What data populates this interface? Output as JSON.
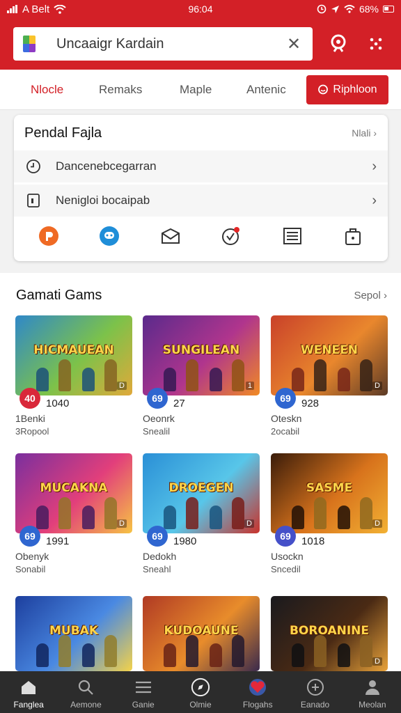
{
  "status_bar": {
    "carrier": "A Belt",
    "time": "96:04",
    "battery": "68%"
  },
  "search": {
    "value": "Uncaaigr Kardain"
  },
  "tabs": [
    {
      "label": "Nlocle",
      "active": true
    },
    {
      "label": "Remaks"
    },
    {
      "label": "Maple"
    },
    {
      "label": "Antenic"
    }
  ],
  "tab_cta": {
    "label": "Riphloon"
  },
  "card": {
    "title": "Pendal Fajla",
    "more": "Nlali",
    "rows": [
      {
        "label": "Dancenebcegarran"
      },
      {
        "label": "Nenigloi bocaipab"
      }
    ]
  },
  "games_section": {
    "title": "Gamati Gams",
    "more": "Sepol",
    "games": [
      {
        "art_title": "HICMAUEAN",
        "tag": "D",
        "badge": "40",
        "rating": "1040",
        "name": "1Benki",
        "sub": "3Ropool",
        "colors": [
          "#2f88c9",
          "#7cc24a",
          "#e0a93a"
        ],
        "badge_color": "#d9283a"
      },
      {
        "art_title": "SUNGILEAN",
        "tag": "1",
        "badge": "69",
        "rating": "27",
        "name": "Oeonrk",
        "sub": "Snealil",
        "colors": [
          "#5a2a8c",
          "#b0358d",
          "#f08a24"
        ],
        "badge_color": "#2f66d0"
      },
      {
        "art_title": "WENEEN",
        "tag": "D",
        "badge": "69",
        "rating": "928",
        "name": "Oteskn",
        "sub": "2ocabil",
        "colors": [
          "#c9412a",
          "#e9872d",
          "#5b3a26"
        ],
        "badge_color": "#2f66d0"
      },
      {
        "art_title": "MUCAKNA",
        "tag": "D",
        "badge": "69",
        "rating": "1991",
        "name": "Obenyk",
        "sub": "Sonabil",
        "colors": [
          "#7a2f9e",
          "#e23f7b",
          "#f6c344"
        ],
        "badge_color": "#2f66d0"
      },
      {
        "art_title": "DROEGEN",
        "tag": "D",
        "badge": "69",
        "rating": "1980",
        "name": "Dedokh",
        "sub": "Sneahl",
        "colors": [
          "#2a8fd6",
          "#58c6e9",
          "#c9322b"
        ],
        "badge_color": "#2f66d0"
      },
      {
        "art_title": "SASME",
        "tag": "D",
        "badge": "69",
        "rating": "1018",
        "name": "Usockn",
        "sub": "Sncedil",
        "colors": [
          "#3a1c0a",
          "#d8731c",
          "#f2b134"
        ],
        "badge_color": "#4550c9"
      },
      {
        "art_title": "MUBAK",
        "tag": "",
        "badge": "",
        "rating": "",
        "name": "",
        "sub": "",
        "colors": [
          "#1d3f9e",
          "#4a89e2",
          "#f3d24a"
        ],
        "badge_color": "#2f66d0"
      },
      {
        "art_title": "KUDOAUNE",
        "tag": "",
        "badge": "",
        "rating": "",
        "name": "",
        "sub": "",
        "colors": [
          "#b03a24",
          "#e88c2b",
          "#3a2a4c"
        ],
        "badge_color": "#2f66d0"
      },
      {
        "art_title": "BOROANINE",
        "tag": "D",
        "badge": "",
        "rating": "",
        "name": "",
        "sub": "",
        "colors": [
          "#1a1a1e",
          "#4a2a14",
          "#e8a23a"
        ],
        "badge_color": "#2f66d0"
      }
    ]
  },
  "bottom_nav": [
    {
      "label": "Fanglea",
      "icon": "home-icon",
      "active": true
    },
    {
      "label": "Aemone",
      "icon": "search-icon"
    },
    {
      "label": "Ganie",
      "icon": "menu-icon"
    },
    {
      "label": "Olmie",
      "icon": "compass-icon"
    },
    {
      "label": "Flogahs",
      "icon": "heart-icon"
    },
    {
      "label": "Eanado",
      "icon": "discover-icon"
    },
    {
      "label": "Meolan",
      "icon": "profile-icon"
    }
  ],
  "colors": {
    "brand_red": "#d32027",
    "nav_bg": "#2c2c2c"
  }
}
